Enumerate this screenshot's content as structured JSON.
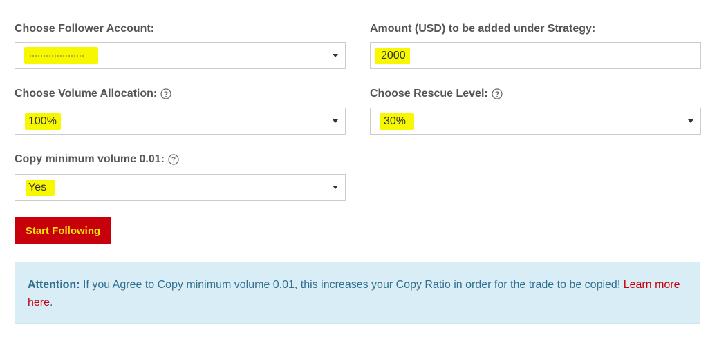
{
  "form": {
    "follower_account": {
      "label": "Choose Follower Account:",
      "value": ""
    },
    "amount": {
      "label": "Amount (USD) to be added under Strategy:",
      "value": "2000"
    },
    "volume_allocation": {
      "label": "Choose Volume Allocation:",
      "value": "100%"
    },
    "rescue_level": {
      "label": "Choose Rescue Level:",
      "value": "30%"
    },
    "copy_min_volume": {
      "label": "Copy minimum volume 0.01:",
      "value": "Yes"
    },
    "submit_label": "Start Following"
  },
  "alert": {
    "title": "Attention:",
    "message": " If you Agree to Copy minimum volume 0.01, this increases your Copy Ratio in order for the trade to be copied! ",
    "link_text": "Learn more here",
    "suffix": "."
  },
  "icons": {
    "help": "question-circle-icon",
    "caret": "caret-down-icon"
  },
  "colors": {
    "highlight": "#f7f700",
    "button_bg": "#c8000c",
    "button_text": "#ffe500",
    "alert_bg": "#d9edf7",
    "alert_text": "#31708f",
    "link": "#c8000c",
    "label": "#555555"
  }
}
